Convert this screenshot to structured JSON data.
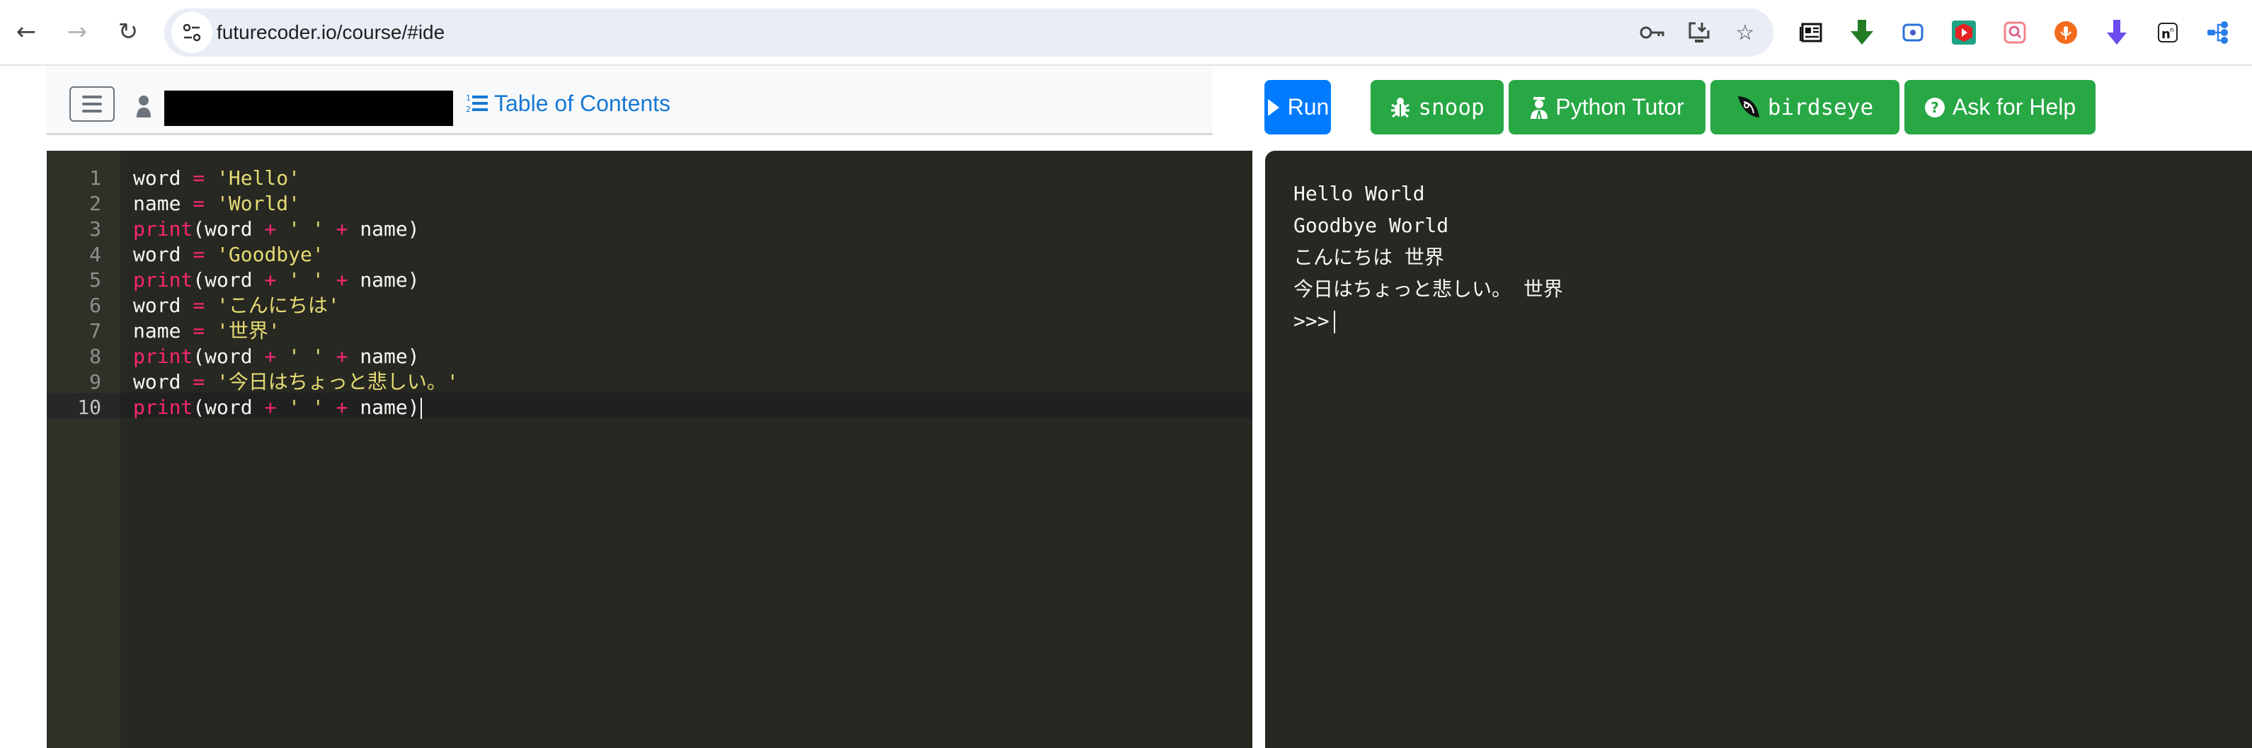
{
  "browser": {
    "url": "futurecoder.io/course/#ide",
    "nav": {
      "back_icon": "arrow-left-icon",
      "forward_icon": "arrow-right-icon",
      "reload_icon": "reload-icon"
    },
    "pill_icons": [
      "key-icon",
      "install-app-icon",
      "star-icon"
    ],
    "extensions": [
      "reader-icon",
      "green-download-icon",
      "screen-record-icon",
      "video-play-icon",
      "image-search-icon",
      "microphone-icon",
      "purple-download-icon",
      "notion-icon",
      "share-tree-icon"
    ]
  },
  "header": {
    "menu_icon": "hamburger-icon",
    "user_icon": "person-icon",
    "toc_label": "Table of Contents"
  },
  "toolbar": {
    "run_label": "Run",
    "snoop_label": "snoop",
    "python_tutor_label": "Python Tutor",
    "birdseye_label": "birdseye",
    "help_label": "Ask for Help",
    "colors": {
      "run": "#007bff",
      "tool": "#28a745"
    }
  },
  "editor": {
    "active_line": 10,
    "lines": [
      {
        "num": "1",
        "tokens": [
          {
            "t": "word ",
            "c": "id"
          },
          {
            "t": "=",
            "c": "op"
          },
          {
            "t": " ",
            "c": "id"
          },
          {
            "t": "'Hello'",
            "c": "str"
          }
        ]
      },
      {
        "num": "2",
        "tokens": [
          {
            "t": "name ",
            "c": "id"
          },
          {
            "t": "=",
            "c": "op"
          },
          {
            "t": " ",
            "c": "id"
          },
          {
            "t": "'World'",
            "c": "str"
          }
        ]
      },
      {
        "num": "3",
        "tokens": [
          {
            "t": "print",
            "c": "kw"
          },
          {
            "t": "(word ",
            "c": "id"
          },
          {
            "t": "+",
            "c": "op"
          },
          {
            "t": " ",
            "c": "id"
          },
          {
            "t": "' '",
            "c": "str"
          },
          {
            "t": " ",
            "c": "id"
          },
          {
            "t": "+",
            "c": "op"
          },
          {
            "t": " name)",
            "c": "id"
          }
        ]
      },
      {
        "num": "4",
        "tokens": [
          {
            "t": "word ",
            "c": "id"
          },
          {
            "t": "=",
            "c": "op"
          },
          {
            "t": " ",
            "c": "id"
          },
          {
            "t": "'Goodbye'",
            "c": "str"
          }
        ]
      },
      {
        "num": "5",
        "tokens": [
          {
            "t": "print",
            "c": "kw"
          },
          {
            "t": "(word ",
            "c": "id"
          },
          {
            "t": "+",
            "c": "op"
          },
          {
            "t": " ",
            "c": "id"
          },
          {
            "t": "' '",
            "c": "str"
          },
          {
            "t": " ",
            "c": "id"
          },
          {
            "t": "+",
            "c": "op"
          },
          {
            "t": " name)",
            "c": "id"
          }
        ]
      },
      {
        "num": "6",
        "tokens": [
          {
            "t": "word ",
            "c": "id"
          },
          {
            "t": "=",
            "c": "op"
          },
          {
            "t": " ",
            "c": "id"
          },
          {
            "t": "'こんにちは'",
            "c": "str"
          }
        ]
      },
      {
        "num": "7",
        "tokens": [
          {
            "t": "name ",
            "c": "id"
          },
          {
            "t": "=",
            "c": "op"
          },
          {
            "t": " ",
            "c": "id"
          },
          {
            "t": "'世界'",
            "c": "str"
          }
        ]
      },
      {
        "num": "8",
        "tokens": [
          {
            "t": "print",
            "c": "kw"
          },
          {
            "t": "(word ",
            "c": "id"
          },
          {
            "t": "+",
            "c": "op"
          },
          {
            "t": " ",
            "c": "id"
          },
          {
            "t": "' '",
            "c": "str"
          },
          {
            "t": " ",
            "c": "id"
          },
          {
            "t": "+",
            "c": "op"
          },
          {
            "t": " name)",
            "c": "id"
          }
        ]
      },
      {
        "num": "9",
        "tokens": [
          {
            "t": "word ",
            "c": "id"
          },
          {
            "t": "=",
            "c": "op"
          },
          {
            "t": " ",
            "c": "id"
          },
          {
            "t": "'今日はちょっと悲しい。'",
            "c": "str"
          }
        ]
      },
      {
        "num": "10",
        "tokens": [
          {
            "t": "print",
            "c": "kw"
          },
          {
            "t": "(word ",
            "c": "id"
          },
          {
            "t": "+",
            "c": "op"
          },
          {
            "t": " ",
            "c": "id"
          },
          {
            "t": "' '",
            "c": "str"
          },
          {
            "t": " ",
            "c": "id"
          },
          {
            "t": "+",
            "c": "op"
          },
          {
            "t": " name)",
            "c": "id"
          }
        ]
      }
    ]
  },
  "terminal": {
    "output": [
      "Hello World",
      "Goodbye World",
      "こんにちは 世界",
      "今日はちょっと悲しい。 世界"
    ],
    "prompt": ">>>"
  }
}
